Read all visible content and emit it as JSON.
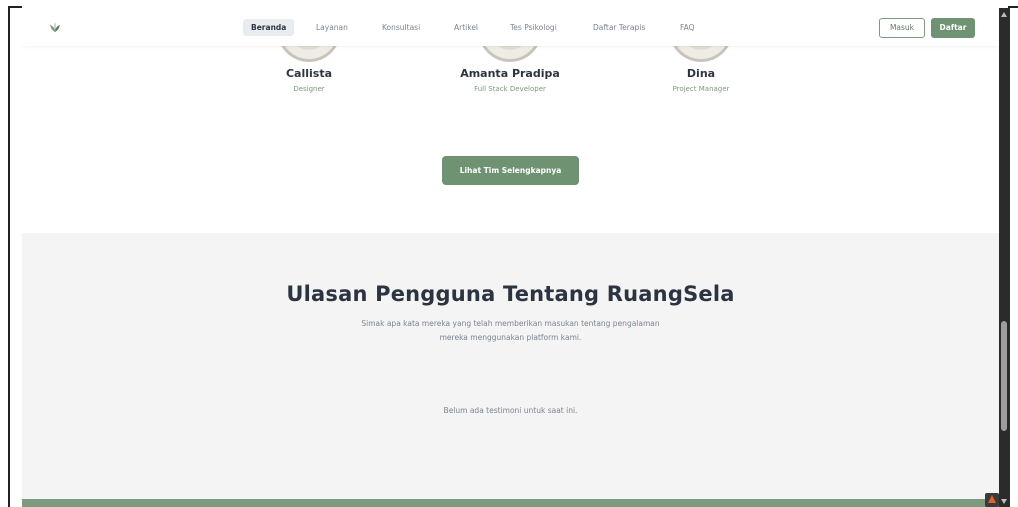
{
  "navbar": {
    "logo_icon": "leaf-icon",
    "items": [
      {
        "label": "Beranda",
        "active": true
      },
      {
        "label": "Layanan",
        "active": false
      },
      {
        "label": "Konsultasi",
        "active": false
      },
      {
        "label": "Artikel",
        "active": false
      },
      {
        "label": "Tes Psikologi",
        "active": false
      },
      {
        "label": "Daftar Terapis",
        "active": false
      },
      {
        "label": "FAQ",
        "active": false
      }
    ],
    "login_label": "Masuk",
    "register_label": "Daftar"
  },
  "team": {
    "members": [
      {
        "name": "Callista",
        "role": "Designer"
      },
      {
        "name": "Amanta Pradipa",
        "role": "Full Stack Developer"
      },
      {
        "name": "Dina",
        "role": "Project Manager"
      }
    ],
    "more_button": "Lihat Tim Selengkapnya"
  },
  "testimonials": {
    "title": "Ulasan Pengguna Tentang RuangSela",
    "subtitle": "Simak apa kata mereka yang telah memberikan masukan tentang pengalaman mereka menggunakan platform kami.",
    "empty_text": "Belum ada testimoni untuk saat ini."
  },
  "colors": {
    "brand_green": "#6f9272",
    "text_dark": "#2d3441",
    "section_bg": "#f4f4f4"
  }
}
